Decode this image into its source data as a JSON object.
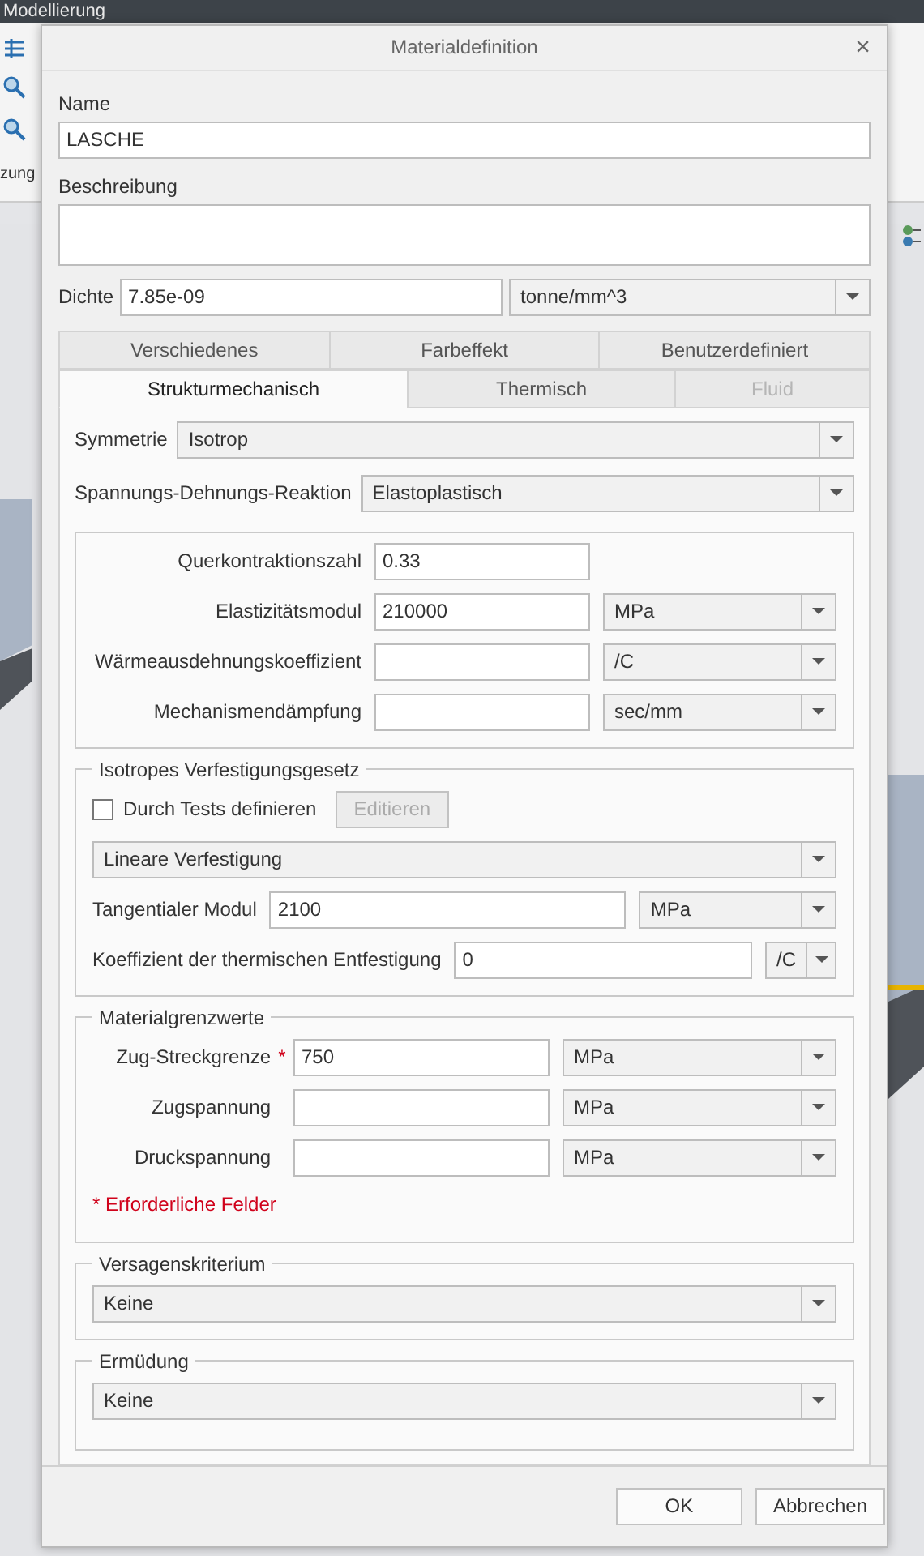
{
  "background": {
    "menu_title": "Modellierung",
    "side_label": "zung"
  },
  "dialog": {
    "title": "Materialdefinition",
    "close": "×",
    "name": {
      "label": "Name",
      "value": "LASCHE"
    },
    "description": {
      "label": "Beschreibung"
    },
    "density": {
      "label": "Dichte",
      "value": "7.85e-09",
      "unit": "tonne/mm^3"
    },
    "tab_rows": [
      [
        {
          "label": "Verschiedenes",
          "selected": false,
          "disabled": false
        },
        {
          "label": "Farbeffekt",
          "selected": false,
          "disabled": false
        },
        {
          "label": "Benutzerdefiniert",
          "selected": false,
          "disabled": false
        }
      ],
      [
        {
          "label": "Strukturmechanisch",
          "selected": true,
          "disabled": false
        },
        {
          "label": "Thermisch",
          "selected": false,
          "disabled": false
        },
        {
          "label": "Fluid",
          "selected": false,
          "disabled": true
        }
      ]
    ],
    "symmetry": {
      "label": "Symmetrie",
      "value": "Isotrop"
    },
    "response": {
      "label": "Spannungs-Dehnungs-Reaktion",
      "value": "Elastoplastisch"
    },
    "properties": [
      {
        "label": "Querkontraktionszahl",
        "value": "0.33"
      },
      {
        "label": "Elastizitätsmodul",
        "value": "210000",
        "unit": "MPa"
      },
      {
        "label": "Wärmeausdehnungskoeffizient",
        "unit": "/C"
      },
      {
        "label": "Mechanismendämpfung",
        "unit": "sec/mm"
      }
    ],
    "hardening": {
      "title": "Isotropes Verfestigungsgesetz",
      "checkbox": {
        "label": "Durch Tests definieren",
        "checked": false
      },
      "edit_button": {
        "label": "Editieren",
        "disabled": true
      },
      "law": "Lineare Verfestigung",
      "tangent": {
        "label": "Tangentialer Modul",
        "value": "2100",
        "unit": "MPa"
      },
      "softening": {
        "label": "Koeffizient der thermischen Entfestigung",
        "value": "0",
        "unit": "/C"
      }
    },
    "limits": {
      "title": "Materialgrenzwerte",
      "rows": [
        {
          "label": "Zug-Streckgrenze",
          "required_mark": "*",
          "value": "750",
          "unit": "MPa"
        },
        {
          "label": "Zugspannung",
          "unit": "MPa"
        },
        {
          "label": "Druckspannung",
          "unit": "MPa"
        }
      ],
      "note": "* Erforderliche Felder"
    },
    "failure": {
      "title": "Versagenskriterium",
      "value": "Keine"
    },
    "fatigue": {
      "title": "Ermüdung",
      "value": "Keine"
    },
    "buttons": [
      {
        "label": "OK"
      },
      {
        "label": "Abbrechen"
      }
    ]
  }
}
